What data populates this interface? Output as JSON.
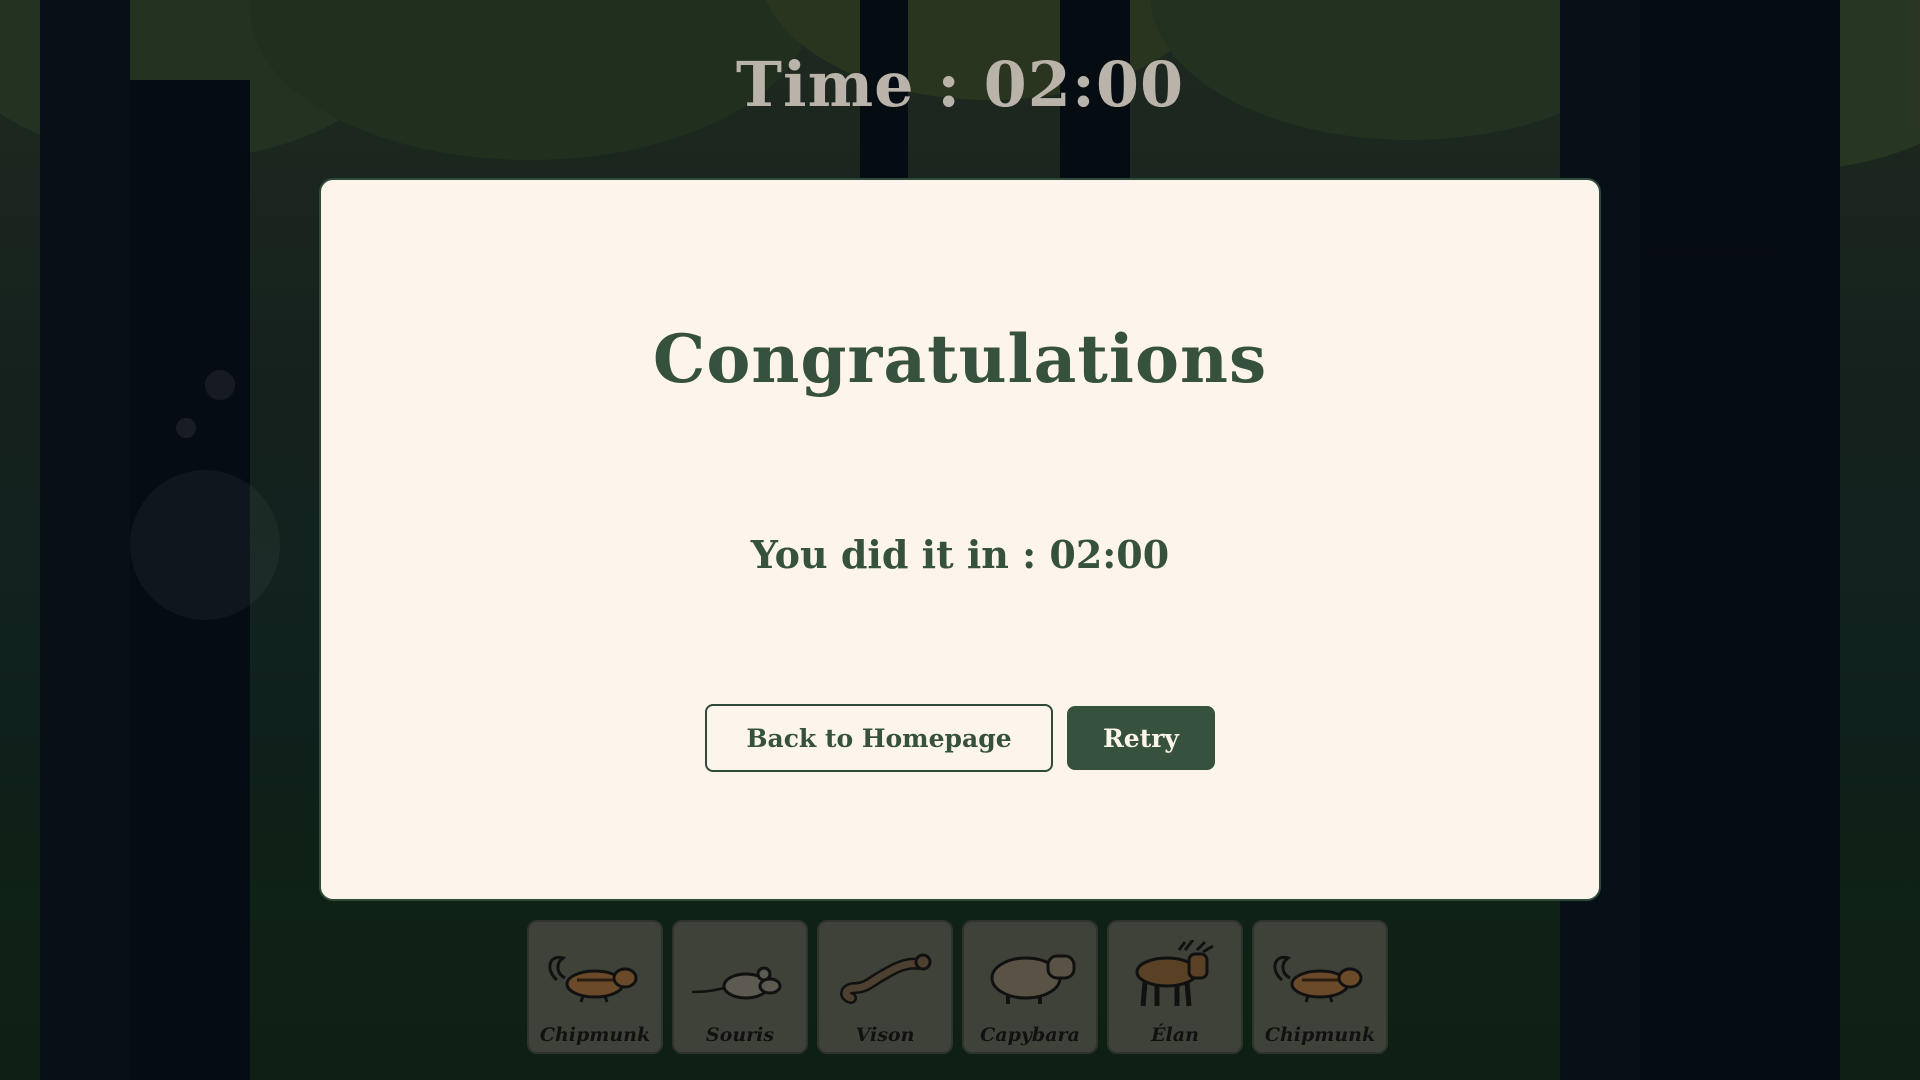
{
  "timer": {
    "label": "Time : 02:00"
  },
  "modal": {
    "title": "Congratulations",
    "result": "You did it in : 02:00",
    "back_label": "Back to Homepage",
    "retry_label": "Retry"
  },
  "cards": [
    {
      "name": "Chipmunk",
      "icon": "chipmunk-icon"
    },
    {
      "name": "Souris",
      "icon": "mouse-icon"
    },
    {
      "name": "Vison",
      "icon": "mink-icon"
    },
    {
      "name": "Capybara",
      "icon": "capybara-icon"
    },
    {
      "name": "Élan",
      "icon": "moose-icon"
    },
    {
      "name": "Chipmunk",
      "icon": "chipmunk-icon"
    }
  ],
  "colors": {
    "primary": "#36513d",
    "modal_bg": "#fdf5eb",
    "timer_text": "#b9b3aa"
  }
}
